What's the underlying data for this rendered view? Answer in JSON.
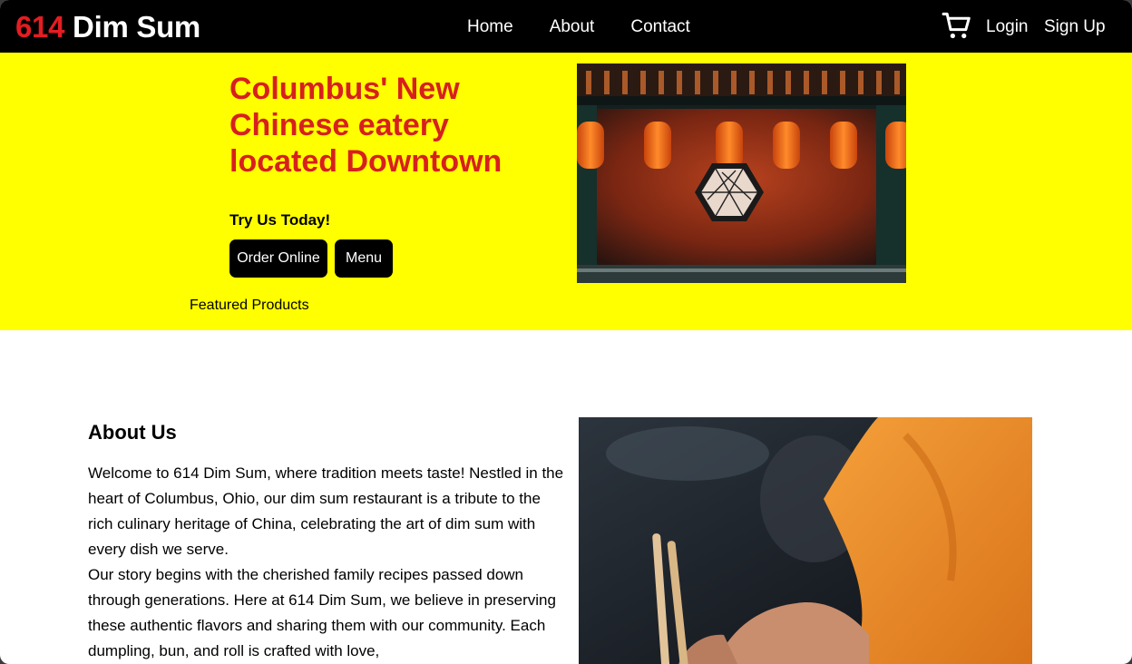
{
  "nav": {
    "brand_number": "614",
    "brand_name": "Dim Sum",
    "links": [
      "Home",
      "About",
      "Contact"
    ],
    "login": "Login",
    "signup": "Sign Up",
    "cart_icon": "shopping-cart-icon"
  },
  "hero": {
    "title": "Columbus' New Chinese eatery located Downtown",
    "subtitle": "Try Us Today!",
    "order_button": "Order Online",
    "menu_button": "Menu",
    "featured": "Featured Products"
  },
  "about": {
    "heading": "About Us",
    "paragraphs": [
      "Welcome to 614 Dim Sum, where tradition meets taste! Nestled in the heart of Columbus, Ohio, our dim sum restaurant is a tribute to the rich culinary heritage of China, celebrating the art of dim sum with every dish we serve.",
      "Our story begins with the cherished family recipes passed down through generations. Here at 614 Dim Sum, we believe in preserving these authentic flavors and sharing them with our community. Each dumpling, bun, and roll is crafted with love,"
    ]
  },
  "colors": {
    "accent_red": "#e41d22",
    "title_red": "#d7201e",
    "hero_bg": "#ffff00",
    "nav_bg": "#000000"
  }
}
